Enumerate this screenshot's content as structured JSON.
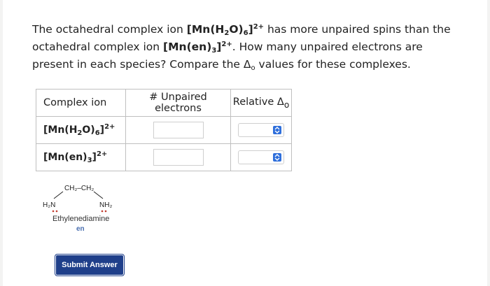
{
  "question": {
    "text_1": "The octahedral complex ion ",
    "ion_1_base": "[Mn(H",
    "ion_1_sub": "2",
    "ion_1_mid": "O)",
    "ion_1_sub2": "6",
    "ion_1_close": "]",
    "ion_1_charge": "2+",
    "text_2": " has more unpaired spins than the octahedral complex ion ",
    "ion_2_base": "[Mn(en)",
    "ion_2_sub": "3",
    "ion_2_close": "]",
    "ion_2_charge": "2+",
    "text_3": ". How many unpaired electrons are present in each species? Compare the Δ",
    "delta_sub": "o",
    "text_4": " values for these complexes."
  },
  "table": {
    "headers": {
      "complex_ion": "Complex ion",
      "unpaired": "# Unpaired electrons",
      "relative": "Relative Δ",
      "relative_sub": "o"
    },
    "rows": [
      {
        "ion_base": "[Mn(H",
        "ion_sub": "2",
        "ion_mid": "O)",
        "ion_sub2": "6",
        "ion_close": "]",
        "ion_charge": "2+",
        "unpaired_value": "",
        "relative_value": ""
      },
      {
        "ion_base": "[Mn(en)",
        "ion_sub": "3",
        "ion_close": "]",
        "ion_charge": "2+",
        "unpaired_value": "",
        "relative_value": ""
      }
    ]
  },
  "structure": {
    "top_label": "CH₂–CH₂",
    "left_label": "H₂N",
    "right_label": "NH₂",
    "name": "Ethylenediamine",
    "abbrev": "en"
  },
  "submit": {
    "label": "Submit Answer"
  },
  "colors": {
    "button": "#1f3f8a",
    "select_arrow": "#2f6fdb",
    "en_label": "#4a6fb0"
  },
  "icons": {
    "select_arrow": "up-down-chevron-icon"
  }
}
